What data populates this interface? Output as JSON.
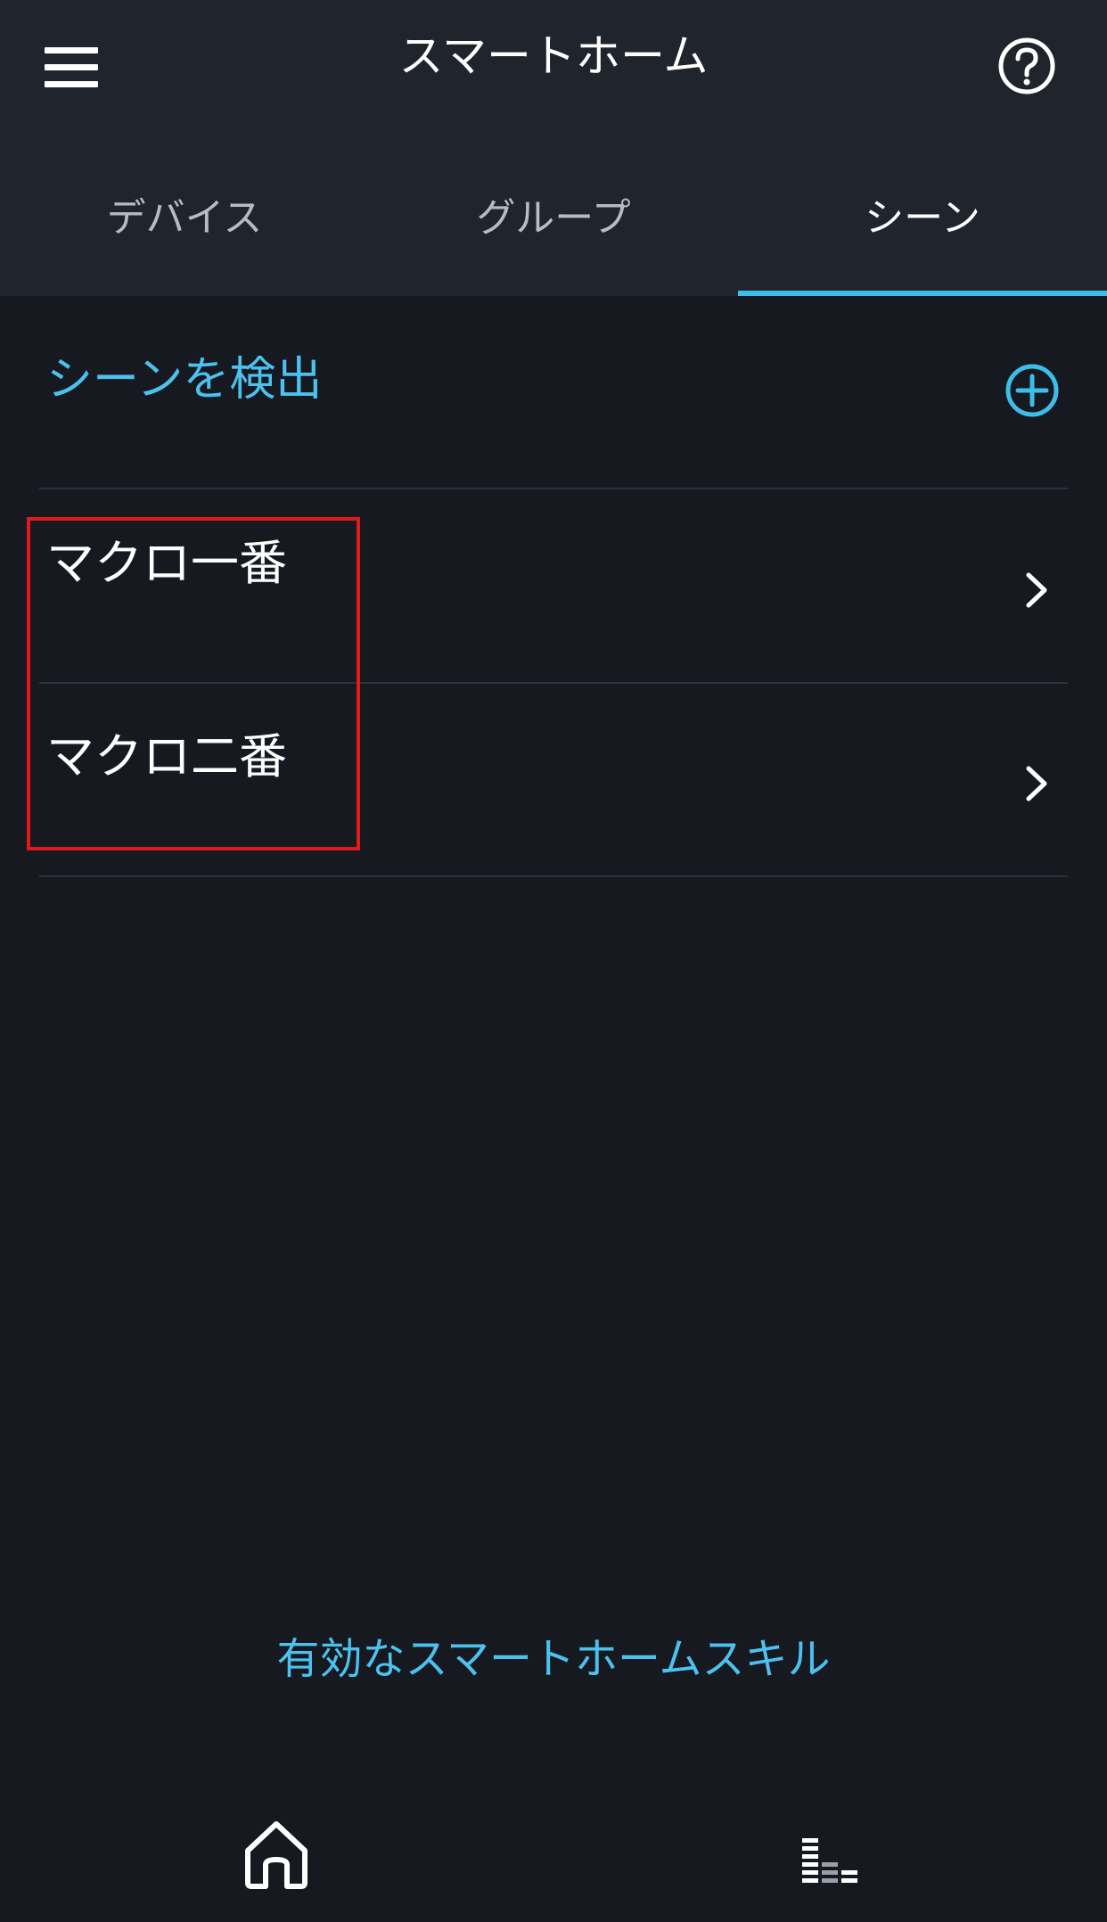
{
  "header": {
    "title": "スマートホーム",
    "menu_icon": "hamburger-menu-icon",
    "help_icon": "question-circle-icon"
  },
  "tabs": [
    {
      "label": "デバイス",
      "active": false
    },
    {
      "label": "グループ",
      "active": false
    },
    {
      "label": "シーン",
      "active": true
    }
  ],
  "scenes": {
    "discover_label": "シーンを検出",
    "add_icon": "plus-circle-icon",
    "items": [
      {
        "name": "マクロ一番",
        "icon": "chevron-right-icon"
      },
      {
        "name": "マクロ二番",
        "icon": "chevron-right-icon"
      }
    ]
  },
  "footer": {
    "skills_link": "有効なスマートホームスキル"
  },
  "bottom_nav": {
    "home_icon": "home-icon",
    "playing_icon": "now-playing-bars-icon"
  },
  "colors": {
    "background": "#161920",
    "header": "#20242c",
    "accent": "#3dbde9",
    "link": "#4cc1ee",
    "highlight": "#e01a1a"
  }
}
